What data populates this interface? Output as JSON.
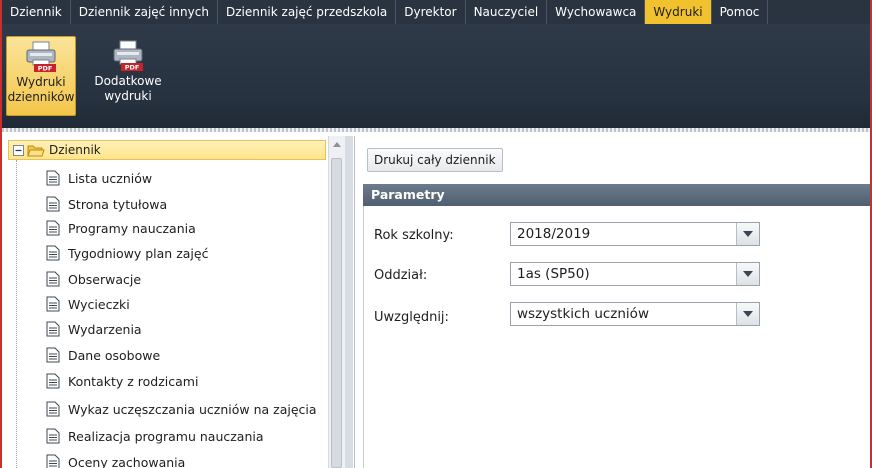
{
  "menu": {
    "tabs": [
      {
        "label": "Dziennik",
        "active": false
      },
      {
        "label": "Dziennik zajęć innych",
        "active": false
      },
      {
        "label": "Dziennik zajęć przedszkola",
        "active": false
      },
      {
        "label": "Dyrektor",
        "active": false
      },
      {
        "label": "Nauczyciel",
        "active": false
      },
      {
        "label": "Wychowawca",
        "active": false
      },
      {
        "label": "Wydruki",
        "active": true
      },
      {
        "label": "Pomoc",
        "active": false
      }
    ]
  },
  "ribbon": {
    "buttons": [
      {
        "line1": "Wydruki",
        "line2": "dzienników",
        "icon": "printer-pdf-icon",
        "badge": "PDF",
        "active": true
      },
      {
        "line1": "Dodatkowe",
        "line2": "wydruki",
        "icon": "printer-pdf-icon",
        "badge": "PDF",
        "active": false
      }
    ]
  },
  "tree": {
    "root_label": "Dziennik",
    "items": [
      "Lista uczniów",
      "Strona tytułowa",
      "Programy nauczania",
      "Tygodniowy plan zajęć",
      "Obserwacje",
      "Wycieczki",
      "Wydarzenia",
      "Dane osobowe",
      "Kontakty z rodzicami",
      "Wykaz uczęszczania uczniów na zajęcia",
      "Realizacja programu nauczania",
      "Oceny zachowania"
    ]
  },
  "right": {
    "print_button": "Drukuj cały dziennik",
    "params_title": "Parametry",
    "fields": [
      {
        "label": "Rok szkolny:",
        "value": "2018/2019"
      },
      {
        "label": "Oddział:",
        "value": "1as (SP50)"
      },
      {
        "label": "Uwzględnij:",
        "value": "wszystkich uczniów"
      }
    ]
  },
  "colors": {
    "accent": "#f2c12e",
    "menubar": "#2a3441",
    "frame_border": "#c9302c"
  }
}
